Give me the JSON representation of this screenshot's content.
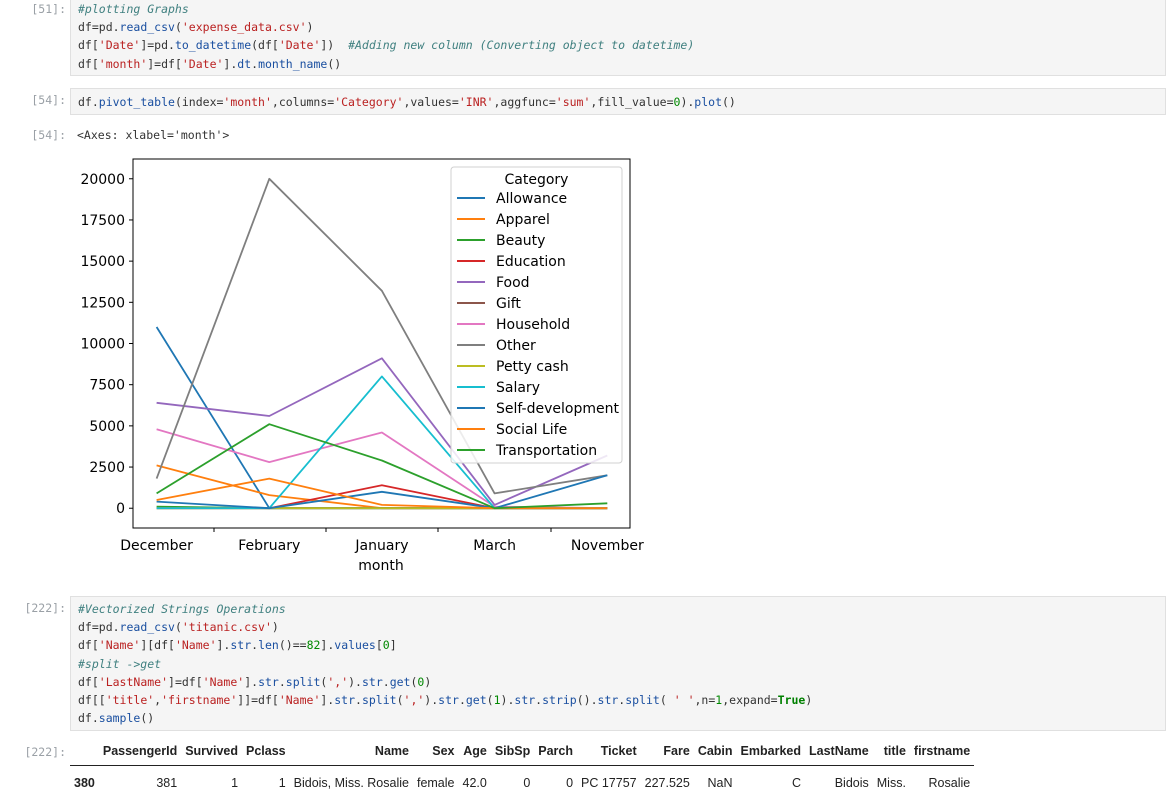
{
  "cells": {
    "c51": {
      "prompt": "[51]:",
      "lines": [
        [
          {
            "t": "#plotting Graphs",
            "c": "cm"
          }
        ],
        [
          {
            "t": "df=pd."
          },
          {
            "t": "read_csv",
            "c": "at"
          },
          {
            "t": "("
          },
          {
            "t": "'expense_data.csv'",
            "c": "st"
          },
          {
            "t": ")"
          }
        ],
        [
          {
            "t": "df["
          },
          {
            "t": "'Date'",
            "c": "st"
          },
          {
            "t": "]=pd."
          },
          {
            "t": "to_datetime",
            "c": "at"
          },
          {
            "t": "(df["
          },
          {
            "t": "'Date'",
            "c": "st"
          },
          {
            "t": "])  "
          },
          {
            "t": "#Adding new column (Converting object to datetime)",
            "c": "cm"
          }
        ],
        [
          {
            "t": "df["
          },
          {
            "t": "'month'",
            "c": "st"
          },
          {
            "t": "]=df["
          },
          {
            "t": "'Date'",
            "c": "st"
          },
          {
            "t": "]."
          },
          {
            "t": "dt",
            "c": "at"
          },
          {
            "t": "."
          },
          {
            "t": "month_name",
            "c": "at"
          },
          {
            "t": "()"
          }
        ]
      ]
    },
    "c54": {
      "prompt": "[54]:",
      "lines": [
        [
          {
            "t": "df."
          },
          {
            "t": "pivot_table",
            "c": "at"
          },
          {
            "t": "(index="
          },
          {
            "t": "'month'",
            "c": "st"
          },
          {
            "t": ",columns="
          },
          {
            "t": "'Category'",
            "c": "st"
          },
          {
            "t": ",values="
          },
          {
            "t": "'INR'",
            "c": "st"
          },
          {
            "t": ",aggfunc="
          },
          {
            "t": "'sum'",
            "c": "st"
          },
          {
            "t": ",fill_value="
          },
          {
            "t": "0",
            "c": "nu"
          },
          {
            "t": ")."
          },
          {
            "t": "plot",
            "c": "at"
          },
          {
            "t": "()"
          }
        ]
      ],
      "out_prompt": "[54]:",
      "out_text": "<Axes: xlabel='month'>"
    },
    "c222": {
      "prompt": "[222]:",
      "lines": [
        [
          {
            "t": "#Vectorized Strings Operations",
            "c": "cm"
          }
        ],
        [
          {
            "t": "df=pd."
          },
          {
            "t": "read_csv",
            "c": "at"
          },
          {
            "t": "("
          },
          {
            "t": "'titanic.csv'",
            "c": "st"
          },
          {
            "t": ")"
          }
        ],
        [
          {
            "t": "df["
          },
          {
            "t": "'Name'",
            "c": "st"
          },
          {
            "t": "][df["
          },
          {
            "t": "'Name'",
            "c": "st"
          },
          {
            "t": "]."
          },
          {
            "t": "str",
            "c": "at"
          },
          {
            "t": "."
          },
          {
            "t": "len",
            "c": "at"
          },
          {
            "t": "()=="
          },
          {
            "t": "82",
            "c": "nu"
          },
          {
            "t": "]."
          },
          {
            "t": "values",
            "c": "at"
          },
          {
            "t": "["
          },
          {
            "t": "0",
            "c": "nu"
          },
          {
            "t": "]"
          }
        ],
        [
          {
            "t": "#split ->get",
            "c": "cm"
          }
        ],
        [
          {
            "t": "df["
          },
          {
            "t": "'LastName'",
            "c": "st"
          },
          {
            "t": "]=df["
          },
          {
            "t": "'Name'",
            "c": "st"
          },
          {
            "t": "]."
          },
          {
            "t": "str",
            "c": "at"
          },
          {
            "t": "."
          },
          {
            "t": "split",
            "c": "at"
          },
          {
            "t": "("
          },
          {
            "t": "','",
            "c": "st"
          },
          {
            "t": ")."
          },
          {
            "t": "str",
            "c": "at"
          },
          {
            "t": "."
          },
          {
            "t": "get",
            "c": "at"
          },
          {
            "t": "("
          },
          {
            "t": "0",
            "c": "nu"
          },
          {
            "t": ")"
          }
        ],
        [
          {
            "t": "df[["
          },
          {
            "t": "'title'",
            "c": "st"
          },
          {
            "t": ","
          },
          {
            "t": "'firstname'",
            "c": "st"
          },
          {
            "t": "]]=df["
          },
          {
            "t": "'Name'",
            "c": "st"
          },
          {
            "t": "]."
          },
          {
            "t": "str",
            "c": "at"
          },
          {
            "t": "."
          },
          {
            "t": "split",
            "c": "at"
          },
          {
            "t": "("
          },
          {
            "t": "','",
            "c": "st"
          },
          {
            "t": ")."
          },
          {
            "t": "str",
            "c": "at"
          },
          {
            "t": "."
          },
          {
            "t": "get",
            "c": "at"
          },
          {
            "t": "("
          },
          {
            "t": "1",
            "c": "nu"
          },
          {
            "t": ")."
          },
          {
            "t": "str",
            "c": "at"
          },
          {
            "t": "."
          },
          {
            "t": "strip",
            "c": "at"
          },
          {
            "t": "()."
          },
          {
            "t": "str",
            "c": "at"
          },
          {
            "t": "."
          },
          {
            "t": "split",
            "c": "at"
          },
          {
            "t": "( "
          },
          {
            "t": "' '",
            "c": "st"
          },
          {
            "t": ",n="
          },
          {
            "t": "1",
            "c": "nu"
          },
          {
            "t": ",expand="
          },
          {
            "t": "True",
            "c": "kw"
          },
          {
            "t": ")"
          }
        ],
        [
          {
            "t": "df."
          },
          {
            "t": "sample",
            "c": "at"
          },
          {
            "t": "()"
          }
        ]
      ],
      "out_prompt": "[222]:"
    }
  },
  "chart_data": {
    "type": "line",
    "categories": [
      "December",
      "February",
      "January",
      "March",
      "November"
    ],
    "xlabel": "month",
    "ylabel": "",
    "ylim": [
      -1200,
      21200
    ],
    "yticks": [
      0,
      2500,
      5000,
      7500,
      10000,
      12500,
      15000,
      17500,
      20000
    ],
    "ytick_labels": [
      "0",
      "2500",
      "5000",
      "7500",
      "10000",
      "12500",
      "15000",
      "17500",
      "20000"
    ],
    "legend_title": "Category",
    "legend_position": "upper right",
    "grid": false,
    "series": [
      {
        "name": "Allowance",
        "color": "#1f77b4",
        "values": [
          11000,
          0,
          0,
          0,
          0
        ]
      },
      {
        "name": "Apparel",
        "color": "#ff7f0e",
        "values": [
          2600,
          800,
          0,
          0,
          0
        ]
      },
      {
        "name": "Beauty",
        "color": "#2ca02c",
        "values": [
          100,
          0,
          0,
          0,
          0
        ]
      },
      {
        "name": "Education",
        "color": "#d62728",
        "values": [
          0,
          0,
          1400,
          0,
          0
        ]
      },
      {
        "name": "Food",
        "color": "#9467bd",
        "values": [
          6400,
          5600,
          9100,
          200,
          3200
        ]
      },
      {
        "name": "Gift",
        "color": "#8c564b",
        "values": [
          0,
          0,
          0,
          0,
          0
        ]
      },
      {
        "name": "Household",
        "color": "#e377c2",
        "values": [
          4800,
          2800,
          4600,
          100,
          0
        ]
      },
      {
        "name": "Other",
        "color": "#7f7f7f",
        "values": [
          1800,
          20000,
          13200,
          900,
          2000
        ]
      },
      {
        "name": "Petty cash",
        "color": "#bcbd22",
        "values": [
          0,
          0,
          0,
          0,
          0
        ]
      },
      {
        "name": "Salary",
        "color": "#17becf",
        "values": [
          0,
          0,
          8000,
          0,
          0
        ]
      },
      {
        "name": "Self-development",
        "color": "#1f77b4",
        "values": [
          400,
          0,
          1000,
          0,
          2000
        ]
      },
      {
        "name": "Social Life",
        "color": "#ff7f0e",
        "values": [
          500,
          1800,
          200,
          0,
          0
        ]
      },
      {
        "name": "Transportation",
        "color": "#2ca02c",
        "values": [
          900,
          5100,
          2900,
          0,
          300
        ]
      }
    ]
  },
  "table": {
    "headers": [
      "",
      "PassengerId",
      "Survived",
      "Pclass",
      "Name",
      "Sex",
      "Age",
      "SibSp",
      "Parch",
      "Ticket",
      "Fare",
      "Cabin",
      "Embarked",
      "LastName",
      "title",
      "firstname"
    ],
    "rows": [
      [
        "380",
        "381",
        "1",
        "1",
        "Bidois, Miss. Rosalie",
        "female",
        "42.0",
        "0",
        "0",
        "PC 17757",
        "227.525",
        "NaN",
        "C",
        "Bidois",
        "Miss.",
        "Rosalie"
      ]
    ]
  }
}
